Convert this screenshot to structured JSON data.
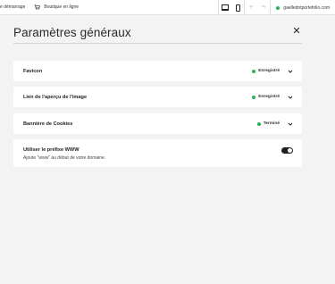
{
  "topbar": {
    "start_label": "e démarrage",
    "shop_label": "Boutique en ligne",
    "domain": "gaelledntportefolio.com"
  },
  "panel": {
    "title": "Paramètres généraux"
  },
  "settings": [
    {
      "label": "Favicon",
      "status": "Enregistré"
    },
    {
      "label": "Lien de l'aperçu de l'image",
      "status": "Enregistré"
    },
    {
      "label": "Bannière de Cookies",
      "status": "Terminé"
    }
  ],
  "www_setting": {
    "label": "Utiliser le préfixe WWW",
    "description": "Ajoute \"www\" au début de votre domaine.",
    "enabled": true
  },
  "colors": {
    "status_dot": "#2bb15a",
    "toggle_on": "#1f1f1f",
    "background": "#f3f3f4"
  },
  "icons": [
    "shopping-cart-icon",
    "desktop-icon",
    "mobile-icon",
    "undo-icon",
    "redo-icon",
    "close-icon",
    "chevron-down-icon"
  ]
}
